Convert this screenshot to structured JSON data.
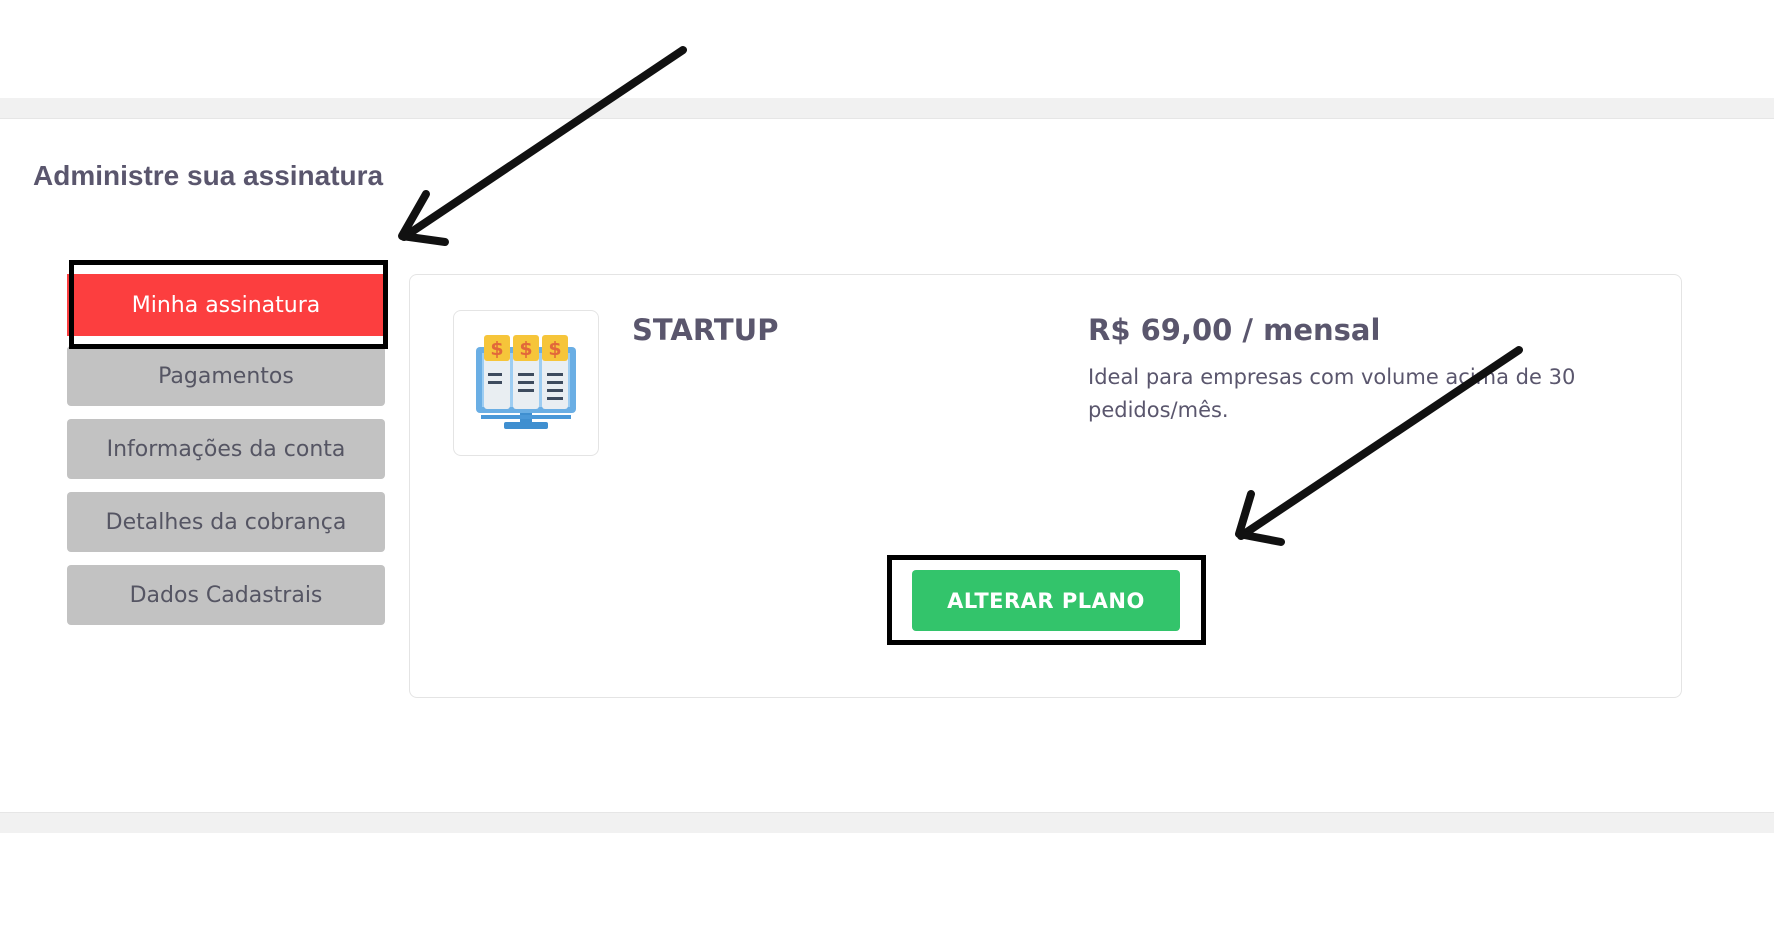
{
  "page": {
    "title": "Administre sua assinatura"
  },
  "nav": {
    "items": [
      {
        "label": "Minha assinatura",
        "active": true
      },
      {
        "label": "Pagamentos",
        "active": false
      },
      {
        "label": "Informações da conta",
        "active": false
      },
      {
        "label": "Detalhes da cobrança",
        "active": false
      },
      {
        "label": "Dados Cadastrais",
        "active": false
      }
    ]
  },
  "plan": {
    "name": "STARTUP",
    "price": "R$ 69,00 / mensal",
    "description": " Ideal para empresas com volume acima de 30 pedidos/mês.",
    "icon": "monitor-billing-icon",
    "change_button_label": "ALTERAR PLANO"
  },
  "colors": {
    "active_nav": "#fc3e3f",
    "inactive_nav": "#c2c2c2",
    "primary_button": "#33c46b",
    "heading_text": "#5a566d"
  }
}
